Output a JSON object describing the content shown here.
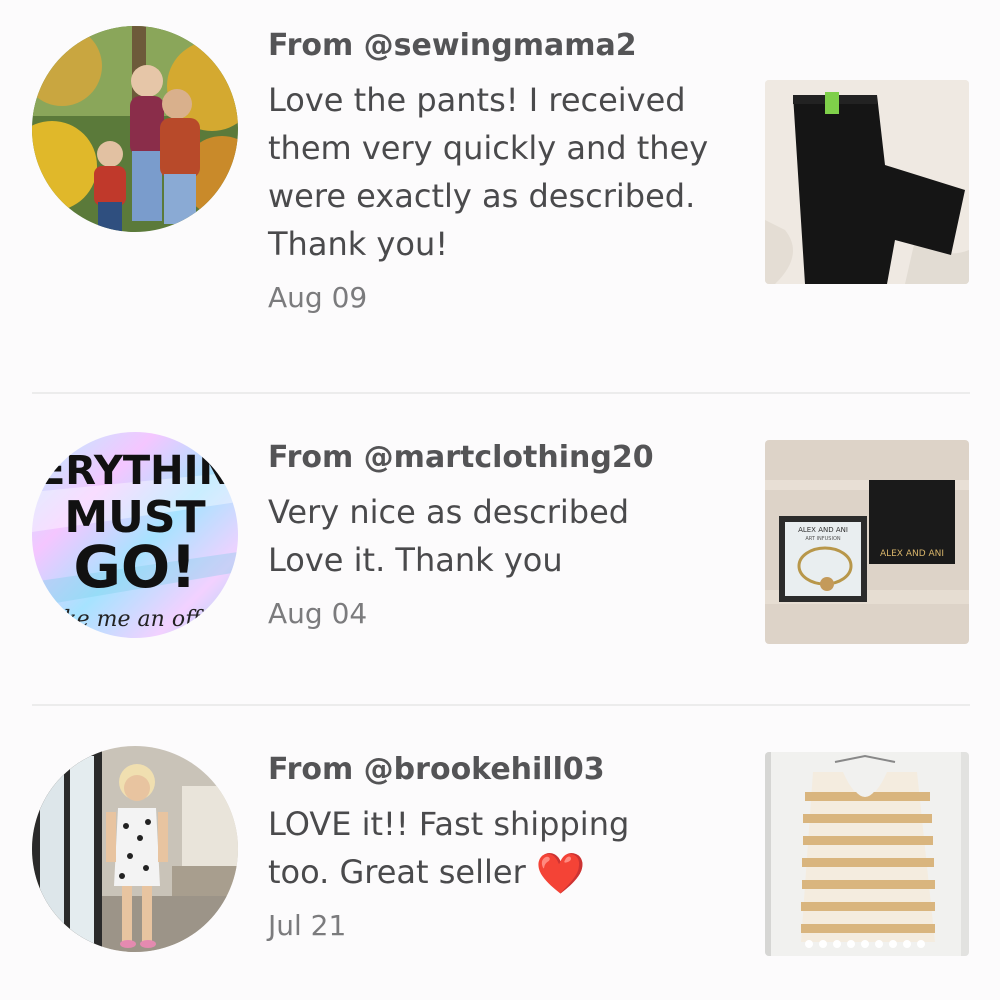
{
  "reviews": [
    {
      "from": "From @sewingmama2",
      "text": "Love the pants! I received them very quickly and they were exactly as described. Thank you!",
      "date": "Aug 09",
      "avatar_icon": "family-photo",
      "item_icon": "black-pants-photo"
    },
    {
      "from": "From @martclothing20",
      "text": "Very nice as described Love it. Thank you",
      "date": "Aug 04",
      "avatar_text": {
        "line1": "ERYTHIN",
        "line2": "MUST",
        "line3": "GO!",
        "line4": "ke me an off"
      },
      "item_icon": "bracelet-box-photo",
      "item_text": {
        "box_label": "ALEX AND ANI",
        "card_label": "ALEX AND ANI",
        "card_sub": "ART INFUSION"
      }
    },
    {
      "from": "From @brookehill03",
      "text": "LOVE it!! Fast shipping too. Great seller",
      "emoji": "❤️",
      "date": "Jul 21",
      "avatar_icon": "woman-photo",
      "item_icon": "striped-tank-photo"
    }
  ],
  "colors": {
    "heart": "#e0151b",
    "divider": "#ececec"
  }
}
